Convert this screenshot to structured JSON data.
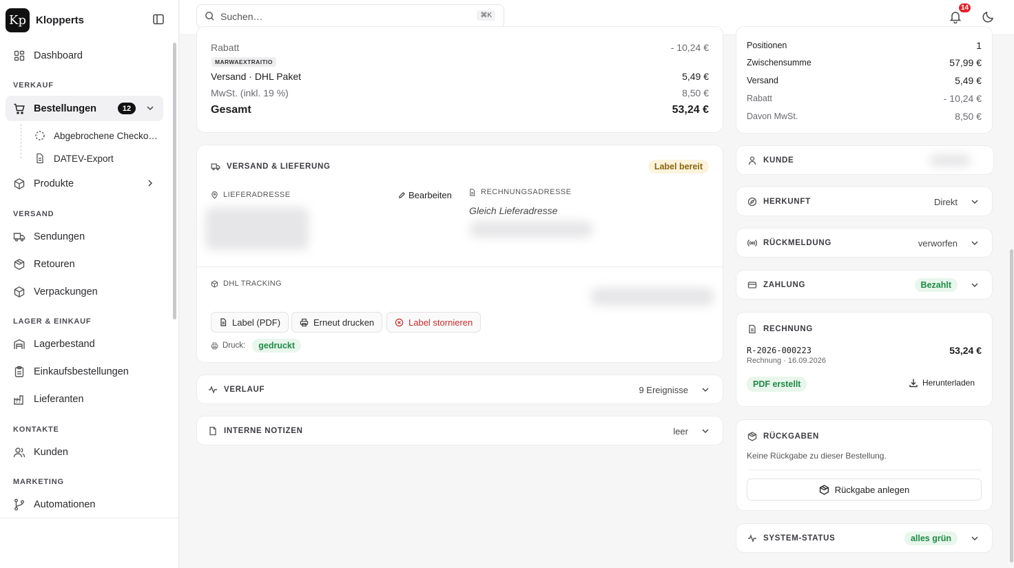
{
  "brand": {
    "logo_text": "Kp",
    "name": "Klopperts"
  },
  "search": {
    "placeholder": "Suchen…",
    "shortcut": "⌘K"
  },
  "notifications": {
    "count": "14"
  },
  "sidebar": {
    "dashboard": "Dashboard",
    "section_verkauf": "VERKAUF",
    "bestellungen": "Bestellungen",
    "bestellungen_count": "12",
    "abgebrochene": "Abgebrochene Checko…",
    "datev": "DATEV-Export",
    "produkte": "Produkte",
    "section_versand": "VERSAND",
    "sendungen": "Sendungen",
    "retouren": "Retouren",
    "verpackungen": "Verpackungen",
    "section_lager": "LAGER & EINKAUF",
    "lagerbestand": "Lagerbestand",
    "einkaufsbestellungen": "Einkaufsbestellungen",
    "lieferanten": "Lieferanten",
    "section_kontakte": "KONTAKTE",
    "kunden": "Kunden",
    "section_marketing": "MARKETING",
    "automationen": "Automationen"
  },
  "totals": {
    "rabatt_label": "Rabatt",
    "rabatt_value": "- 10,24 €",
    "coupon": "MARWAEXTRAITIO",
    "versand_label": "Versand · DHL Paket",
    "versand_value": "5,49 €",
    "mwst_label": "MwSt. (inkl. 19 %)",
    "mwst_value": "8,50 €",
    "gesamt_label": "Gesamt",
    "gesamt_value": "53,24 €"
  },
  "shipping": {
    "title": "VERSAND & LIEFERUNG",
    "status": "Label bereit",
    "lieferadresse": "LIEFERADRESSE",
    "edit": "Bearbeiten",
    "rechnungsadresse": "RECHNUNGSADRESSE",
    "same_as": "Gleich Lieferadresse",
    "tracking": "DHL TRACKING",
    "btn_label_pdf": "Label (PDF)",
    "btn_reprint": "Erneut drucken",
    "btn_cancel": "Label stornieren",
    "print_label": "Druck:",
    "print_status": "gedruckt"
  },
  "verlauf": {
    "title": "VERLAUF",
    "count": "9 Ereignisse"
  },
  "notes": {
    "title": "INTERNE NOTIZEN",
    "value": "leer"
  },
  "summary": {
    "positionen_label": "Positionen",
    "positionen_value": "1",
    "zwischensumme_label": "Zwischensumme",
    "zwischensumme_value": "57,99 €",
    "versand_label": "Versand",
    "versand_value": "5,49 €",
    "rabatt_label": "Rabatt",
    "rabatt_value": "- 10,24 €",
    "mwst_label": "Davon MwSt.",
    "mwst_value": "8,50 €"
  },
  "kunde": {
    "title": "KUNDE"
  },
  "herkunft": {
    "title": "HERKUNFT",
    "value": "Direkt"
  },
  "rueckmeldung": {
    "title": "RÜCKMELDUNG",
    "value": "verworfen"
  },
  "zahlung": {
    "title": "ZAHLUNG",
    "value": "Bezahlt"
  },
  "rechnung": {
    "title": "RECHNUNG",
    "number": "R-2026-000223",
    "sub": "Rechnung · 16.09.2026",
    "amount": "53,24 €",
    "status": "PDF erstellt",
    "download": "Herunterladen"
  },
  "rueckgaben": {
    "title": "RÜCKGABEN",
    "text": "Keine Rückgabe zu dieser Bestellung.",
    "button": "Rückgabe anlegen"
  },
  "system": {
    "title": "SYSTEM-STATUS",
    "value": "alles grün"
  }
}
